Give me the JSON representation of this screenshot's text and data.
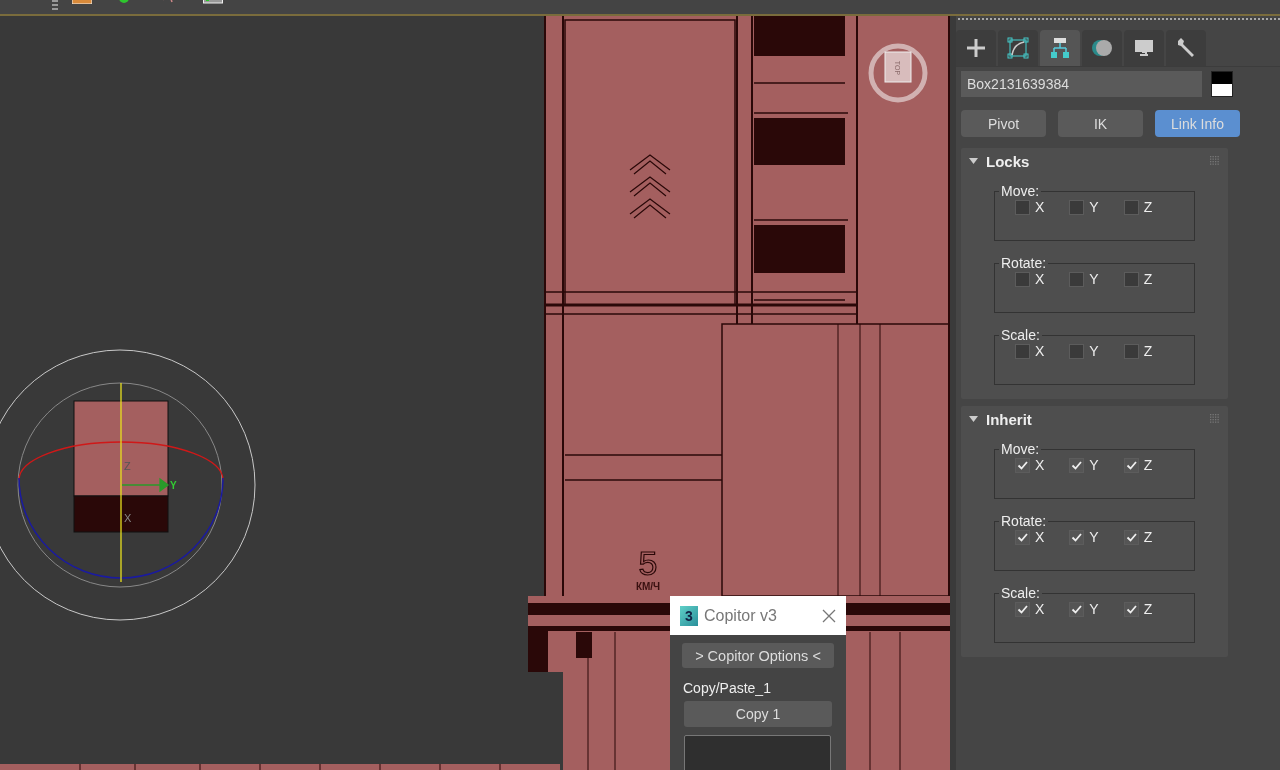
{
  "toolbar": {
    "icons": [
      {
        "kind": "orange"
      },
      {
        "kind": "green"
      },
      {
        "kind": "tool"
      },
      {
        "kind": "frame"
      }
    ]
  },
  "viewport": {
    "speed_number": "5",
    "speed_unit": "КМ/Ч",
    "viewcube_face": "TOP",
    "gizmo_axes": {
      "z": "Z",
      "x": "X",
      "y": "Y"
    }
  },
  "copitor": {
    "logo": "3",
    "title": "Copitor v3",
    "options_button": "> Copitor Options <",
    "group": "Copy/Paste_1",
    "copy_button": "Copy 1"
  },
  "command_panel": {
    "tabs": [
      {
        "kind": "create",
        "selected": false
      },
      {
        "kind": "modify",
        "selected": false
      },
      {
        "kind": "hierarchy",
        "selected": true
      },
      {
        "kind": "motion",
        "selected": false
      },
      {
        "kind": "display",
        "selected": false
      },
      {
        "kind": "utilities",
        "selected": false
      }
    ],
    "object_name": "Box2131639384",
    "sub_buttons": [
      {
        "label": "Pivot",
        "selected": false
      },
      {
        "label": "IK",
        "selected": false
      },
      {
        "label": "Link Info",
        "selected": true
      }
    ],
    "rollouts": [
      {
        "title": "Locks",
        "expanded": true,
        "groups": [
          {
            "label": "Move:",
            "axes": [
              {
                "label": "X",
                "checked": false
              },
              {
                "label": "Y",
                "checked": false
              },
              {
                "label": "Z",
                "checked": false
              }
            ]
          },
          {
            "label": "Rotate:",
            "axes": [
              {
                "label": "X",
                "checked": false
              },
              {
                "label": "Y",
                "checked": false
              },
              {
                "label": "Z",
                "checked": false
              }
            ]
          },
          {
            "label": "Scale:",
            "axes": [
              {
                "label": "X",
                "checked": false
              },
              {
                "label": "Y",
                "checked": false
              },
              {
                "label": "Z",
                "checked": false
              }
            ]
          }
        ]
      },
      {
        "title": "Inherit",
        "expanded": true,
        "groups": [
          {
            "label": "Move:",
            "axes": [
              {
                "label": "X",
                "checked": true
              },
              {
                "label": "Y",
                "checked": true
              },
              {
                "label": "Z",
                "checked": true
              }
            ]
          },
          {
            "label": "Rotate:",
            "axes": [
              {
                "label": "X",
                "checked": true
              },
              {
                "label": "Y",
                "checked": true
              },
              {
                "label": "Z",
                "checked": true
              }
            ]
          },
          {
            "label": "Scale:",
            "axes": [
              {
                "label": "X",
                "checked": true
              },
              {
                "label": "Y",
                "checked": true
              },
              {
                "label": "Z",
                "checked": true
              }
            ]
          }
        ]
      }
    ]
  }
}
